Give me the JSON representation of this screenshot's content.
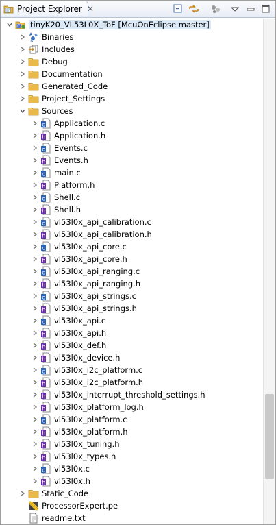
{
  "view": {
    "title": "Project Explorer",
    "close_glyph": "✕",
    "toolbar": [
      {
        "name": "collapse-all-icon"
      },
      {
        "name": "link-with-editor-icon"
      },
      {
        "name": "view-filters-icon"
      },
      {
        "name": "view-menu-icon"
      },
      {
        "name": "minimize-icon"
      },
      {
        "name": "maximize-icon"
      }
    ]
  },
  "tree": {
    "root": "tinyK20_VL53L0X_ToF  [McuOnEclipse master]",
    "root_items": [
      {
        "label": "Binaries",
        "icon": "binaries-icon",
        "arrow": "collapsed"
      },
      {
        "label": "Includes",
        "icon": "includes-icon",
        "arrow": "collapsed"
      },
      {
        "label": "Debug",
        "icon": "folder-icon",
        "arrow": "collapsed"
      },
      {
        "label": "Documentation",
        "icon": "folder-icon",
        "arrow": "collapsed"
      },
      {
        "label": "Generated_Code",
        "icon": "folder-icon",
        "arrow": "collapsed"
      },
      {
        "label": "Project_Settings",
        "icon": "folder-icon",
        "arrow": "collapsed"
      },
      {
        "label": "Sources",
        "icon": "folder-icon",
        "arrow": "expanded"
      }
    ],
    "sources": [
      {
        "label": "Application.c",
        "kind": "c"
      },
      {
        "label": "Application.h",
        "kind": "h"
      },
      {
        "label": "Events.c",
        "kind": "c"
      },
      {
        "label": "Events.h",
        "kind": "h"
      },
      {
        "label": "main.c",
        "kind": "c"
      },
      {
        "label": "Platform.h",
        "kind": "h"
      },
      {
        "label": "Shell.c",
        "kind": "c"
      },
      {
        "label": "Shell.h",
        "kind": "h"
      },
      {
        "label": "vl53l0x_api_calibration.c",
        "kind": "c"
      },
      {
        "label": "vl53l0x_api_calibration.h",
        "kind": "h"
      },
      {
        "label": "vl53l0x_api_core.c",
        "kind": "c"
      },
      {
        "label": "vl53l0x_api_core.h",
        "kind": "h"
      },
      {
        "label": "vl53l0x_api_ranging.c",
        "kind": "c"
      },
      {
        "label": "vl53l0x_api_ranging.h",
        "kind": "h"
      },
      {
        "label": "vl53l0x_api_strings.c",
        "kind": "c"
      },
      {
        "label": "vl53l0x_api_strings.h",
        "kind": "h"
      },
      {
        "label": "vl53l0x_api.c",
        "kind": "c"
      },
      {
        "label": "vl53l0x_api.h",
        "kind": "h"
      },
      {
        "label": "vl53l0x_def.h",
        "kind": "h"
      },
      {
        "label": "vl53l0x_device.h",
        "kind": "h"
      },
      {
        "label": "vl53l0x_i2c_platform.c",
        "kind": "c"
      },
      {
        "label": "vl53l0x_i2c_platform.h",
        "kind": "h"
      },
      {
        "label": "vl53l0x_interrupt_threshold_settings.h",
        "kind": "h"
      },
      {
        "label": "vl53l0x_platform_log.h",
        "kind": "h"
      },
      {
        "label": "vl53l0x_platform.c",
        "kind": "c"
      },
      {
        "label": "vl53l0x_platform.h",
        "kind": "h"
      },
      {
        "label": "vl53l0x_tuning.h",
        "kind": "h"
      },
      {
        "label": "vl53l0x_types.h",
        "kind": "h"
      },
      {
        "label": "vl53l0x.c",
        "kind": "c"
      },
      {
        "label": "vl53l0x.h",
        "kind": "h"
      }
    ],
    "tail_items": [
      {
        "label": "Static_Code",
        "icon": "folder-icon",
        "arrow": "collapsed"
      },
      {
        "label": "ProcessorExpert.pe",
        "icon": "processor-expert-icon",
        "arrow": "none"
      },
      {
        "label": "readme.txt",
        "icon": "text-file-icon",
        "arrow": "none"
      }
    ]
  },
  "colors": {
    "selection": "#dce9f7",
    "folder": "#e9b949",
    "c_badge": "#2d64b8",
    "h_badge": "#6a2cb0"
  }
}
